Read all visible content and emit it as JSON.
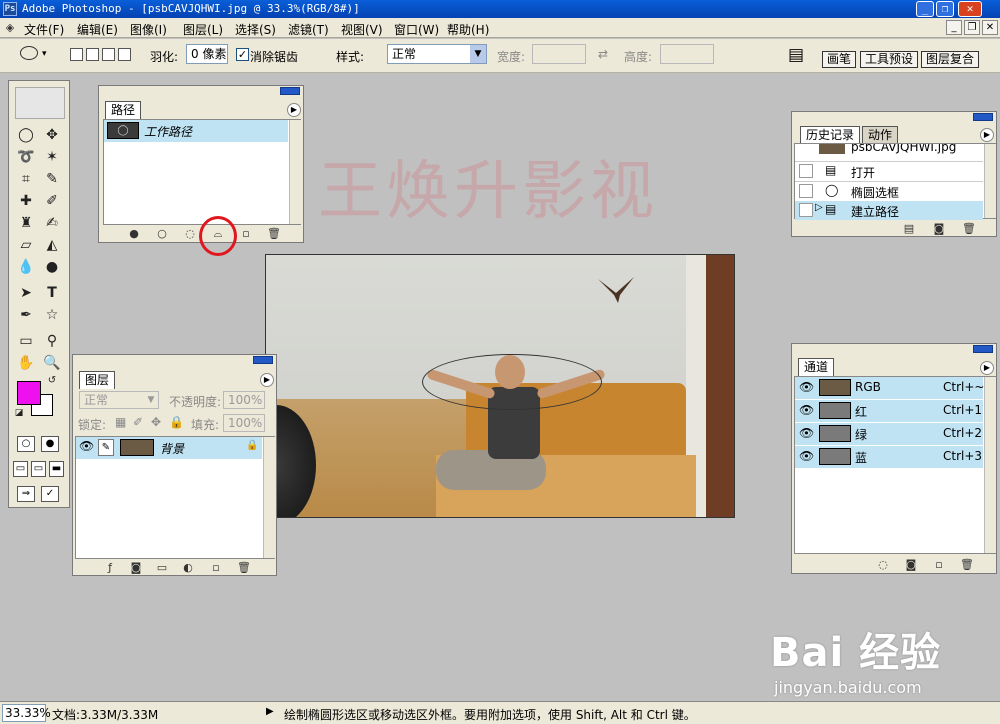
{
  "app": {
    "window_title": "Adobe Photoshop - [psbCAVJQHWI.jpg @ 33.3%(RGB/8#)]"
  },
  "menubar": {
    "items": [
      "文件(F)",
      "编辑(E)",
      "图像(I)",
      "图层(L)",
      "选择(S)",
      "滤镜(T)",
      "视图(V)",
      "窗口(W)",
      "帮助(H)"
    ]
  },
  "options": {
    "feather_label": "羽化:",
    "feather_value": "0 像素",
    "antialias_label": "消除锯齿",
    "antialias_checked": "✓",
    "style_label": "样式:",
    "style_value": "正常",
    "width_label": "宽度:",
    "height_label": "高度:"
  },
  "palette_tabs": [
    "画笔",
    "工具预设",
    "图层复合"
  ],
  "paths_panel": {
    "tab": "路径",
    "rows": [
      {
        "label": "工作路径"
      }
    ]
  },
  "layers_panel": {
    "tab": "图层",
    "blend_mode": "正常",
    "opacity_label": "不透明度:",
    "opacity_value": "100%",
    "lock_label": "锁定:",
    "fill_label": "填充:",
    "fill_value": "100%",
    "rows": [
      {
        "label": "背景"
      }
    ]
  },
  "history_panel": {
    "tabs": [
      "历史记录",
      "动作"
    ],
    "snapshot": "psbCAVJQHWI.jpg",
    "items": [
      "打开",
      "椭圆选框",
      "建立路径"
    ]
  },
  "channels_panel": {
    "tab": "通道",
    "rows": [
      {
        "name": "RGB",
        "shortcut": "Ctrl+~"
      },
      {
        "name": "红",
        "shortcut": "Ctrl+1"
      },
      {
        "name": "绿",
        "shortcut": "Ctrl+2"
      },
      {
        "name": "蓝",
        "shortcut": "Ctrl+3"
      }
    ]
  },
  "watermark": "王焕升影视",
  "baidu": {
    "logo": "Bai 经验",
    "url": "jingyan.baidu.com"
  },
  "statusbar": {
    "zoom": "33.33%",
    "doc_info": "文档:3.33M/3.33M",
    "hint": "绘制椭圆形选区或移动选区外框。要用附加选项，使用 Shift, Alt 和 Ctrl 键。"
  },
  "colors": {
    "foreground": "#ef10ef",
    "background": "#ffffff",
    "title_bar": "#0a5fd8",
    "selection": "#bfe3f2",
    "annotation": "#e0171e"
  }
}
